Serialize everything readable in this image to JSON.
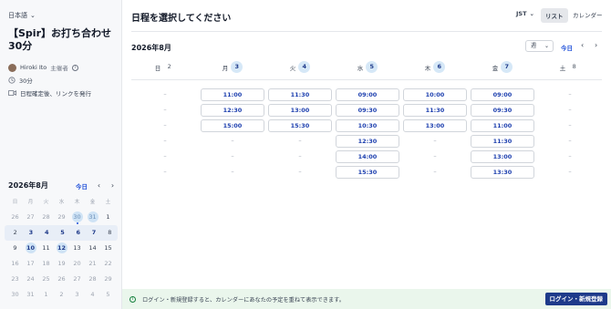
{
  "sidebar": {
    "language": "日本語",
    "title": "【Spir】お打ち合わせ30分",
    "host_name": "Hiroki Ito",
    "host_tag": "主催者",
    "duration": "30分",
    "meeting_note": "日程確定後、リンクを発行",
    "mini_calendar": {
      "month": "2026年8月",
      "today_label": "今日",
      "weekdays": [
        "日",
        "月",
        "火",
        "水",
        "木",
        "金",
        "土"
      ],
      "weeks": [
        [
          {
            "d": "26",
            "muted": true
          },
          {
            "d": "27",
            "muted": true
          },
          {
            "d": "28",
            "muted": true
          },
          {
            "d": "29",
            "muted": true
          },
          {
            "d": "30",
            "muted": true,
            "circle": true,
            "dot": true
          },
          {
            "d": "31",
            "muted": true,
            "circle": true
          },
          {
            "d": "1"
          }
        ],
        [
          {
            "d": "2"
          },
          {
            "d": "3",
            "bold": true
          },
          {
            "d": "4",
            "bold": true
          },
          {
            "d": "5",
            "bold": true
          },
          {
            "d": "6",
            "bold": true
          },
          {
            "d": "7",
            "bold": true
          },
          {
            "d": "8"
          }
        ],
        [
          {
            "d": "9"
          },
          {
            "d": "10",
            "circle": true
          },
          {
            "d": "11"
          },
          {
            "d": "12",
            "circle": true
          },
          {
            "d": "13"
          },
          {
            "d": "14"
          },
          {
            "d": "15"
          }
        ],
        [
          {
            "d": "16",
            "muted": true
          },
          {
            "d": "17",
            "muted": true
          },
          {
            "d": "18",
            "muted": true
          },
          {
            "d": "19",
            "muted": true
          },
          {
            "d": "20",
            "muted": true
          },
          {
            "d": "21",
            "muted": true
          },
          {
            "d": "22",
            "muted": true
          }
        ],
        [
          {
            "d": "23",
            "muted": true
          },
          {
            "d": "24",
            "muted": true
          },
          {
            "d": "25",
            "muted": true
          },
          {
            "d": "26",
            "muted": true
          },
          {
            "d": "27",
            "muted": true
          },
          {
            "d": "28",
            "muted": true
          },
          {
            "d": "29",
            "muted": true
          }
        ],
        [
          {
            "d": "30",
            "muted": true
          },
          {
            "d": "31",
            "muted": true
          },
          {
            "d": "1",
            "muted": true
          },
          {
            "d": "2",
            "muted": true
          },
          {
            "d": "3",
            "muted": true
          },
          {
            "d": "4",
            "muted": true
          },
          {
            "d": "5",
            "muted": true
          }
        ]
      ],
      "active_week_index": 1
    }
  },
  "main": {
    "heading": "日程を選択してください",
    "timezone": "JST",
    "view_list": "リスト",
    "view_calendar": "カレンダー",
    "month_label": "2026年8月",
    "week_select": "週",
    "today_label": "今日",
    "days": [
      {
        "dow": "日",
        "num": "2",
        "highlight": false,
        "slots": [
          "–",
          "–",
          "–",
          "–",
          "–",
          "–"
        ]
      },
      {
        "dow": "月",
        "num": "3",
        "highlight": true,
        "slots": [
          "11:00",
          "12:30",
          "15:00",
          "–",
          "–",
          "–"
        ]
      },
      {
        "dow": "火",
        "num": "4",
        "highlight": true,
        "slots": [
          "11:30",
          "13:00",
          "15:30",
          "–",
          "–",
          "–"
        ]
      },
      {
        "dow": "水",
        "num": "5",
        "highlight": true,
        "slots": [
          "09:00",
          "09:30",
          "10:30",
          "12:30",
          "14:00",
          "15:30"
        ]
      },
      {
        "dow": "木",
        "num": "6",
        "highlight": true,
        "slots": [
          "10:00",
          "11:30",
          "13:00",
          "–",
          "–",
          "–"
        ]
      },
      {
        "dow": "金",
        "num": "7",
        "highlight": true,
        "slots": [
          "09:00",
          "09:30",
          "11:00",
          "11:30",
          "13:00",
          "13:30"
        ]
      },
      {
        "dow": "土",
        "num": "8",
        "highlight": false,
        "slots": [
          "–",
          "–",
          "–",
          "–",
          "–",
          "–"
        ]
      }
    ]
  },
  "banner": {
    "message": "ログイン・新規登録すると、カレンダーにあなたの予定を重ねて表示できます。",
    "button": "ログイン・新規登録"
  },
  "colors": {
    "accent": "#1e3a8a",
    "slot_text": "#1e40af",
    "day_circle": "#d6e8f7",
    "banner_bg": "#eaf6ec"
  }
}
